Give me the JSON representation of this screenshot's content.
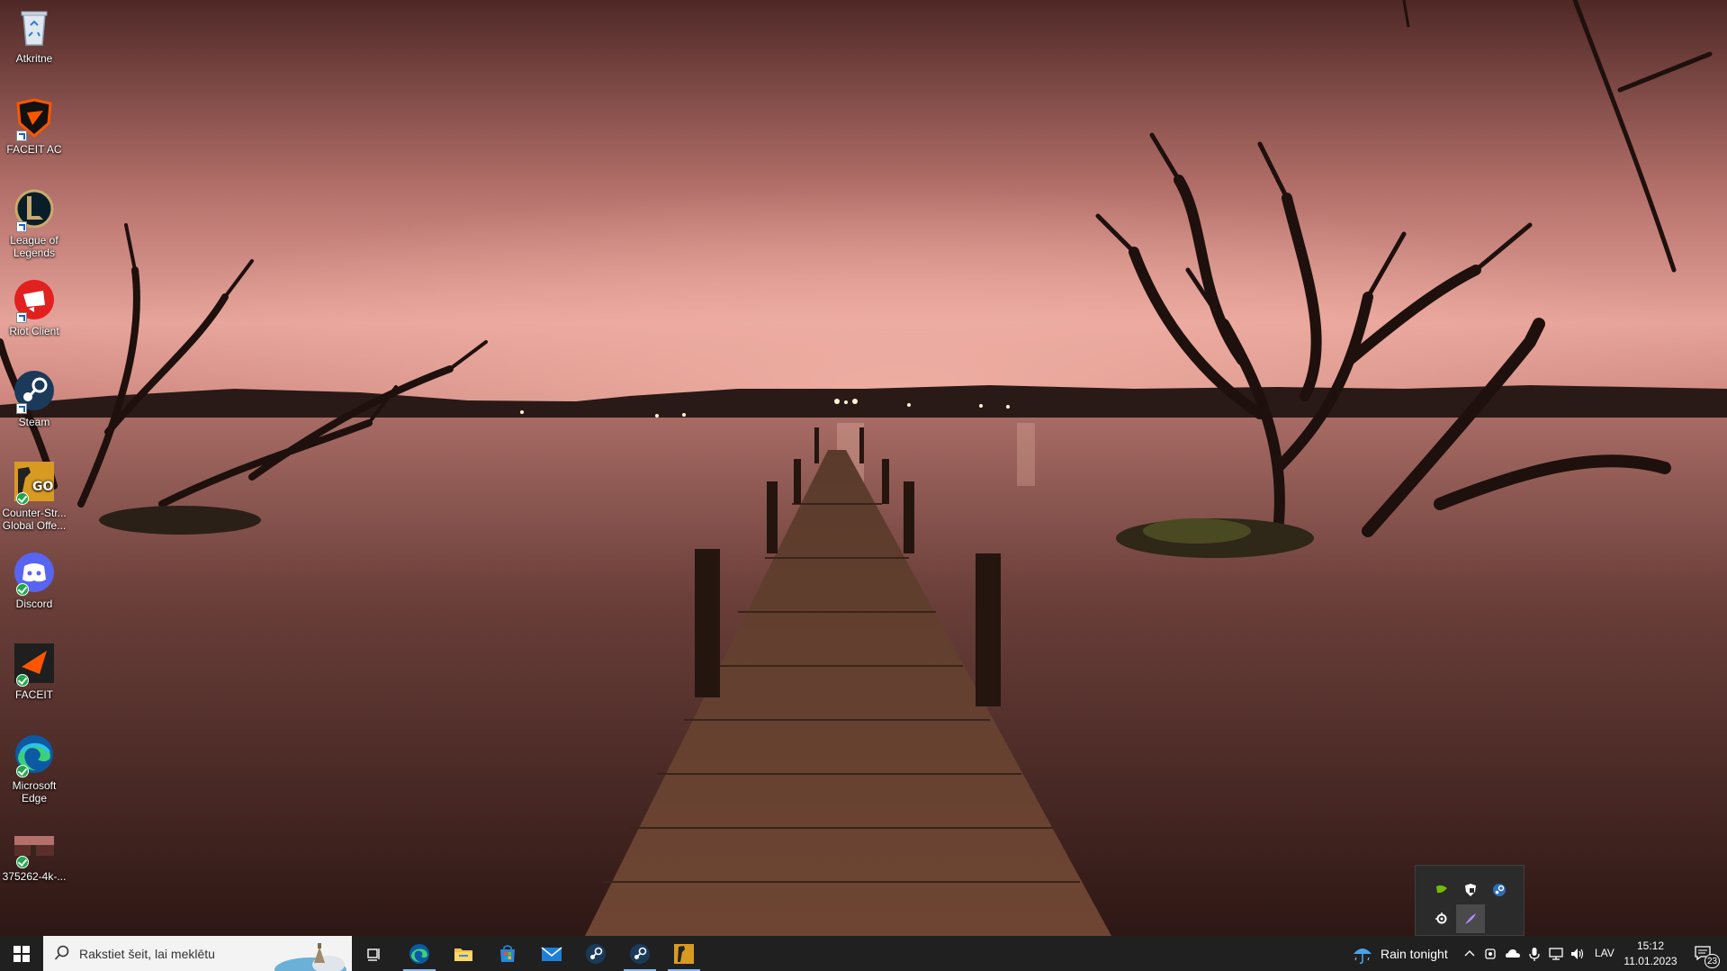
{
  "desktop": {
    "icons": [
      {
        "name": "recycle-bin-icon",
        "label": "Atkritne"
      },
      {
        "name": "faceit-ac-icon",
        "label": "FACEIT AC"
      },
      {
        "name": "league-of-legends-icon",
        "label": "League of Legends"
      },
      {
        "name": "riot-client-icon",
        "label": "Riot Client"
      },
      {
        "name": "steam-icon",
        "label": "Steam"
      },
      {
        "name": "csgo-icon",
        "label": "Counter-Str... Global Offe..."
      },
      {
        "name": "discord-icon",
        "label": "Discord"
      },
      {
        "name": "faceit-icon",
        "label": "FACEIT"
      },
      {
        "name": "microsoft-edge-icon",
        "label": "Microsoft Edge"
      },
      {
        "name": "wallpaper-file-icon",
        "label": "375262-4k-..."
      }
    ]
  },
  "taskbar": {
    "search_placeholder": "Rakstiet šeit, lai meklētu",
    "apps": [
      "task-view-icon",
      "edge-icon",
      "file-explorer-icon",
      "microsoft-store-icon",
      "mail-icon",
      "steam-icon",
      "steam-icon",
      "csgo-icon"
    ],
    "weather": "Rain tonight",
    "language": "LAV",
    "time": "15:12",
    "date": "11.01.2023",
    "notifications_count": "23"
  },
  "tray_overflow": {
    "icons": [
      "nvidia-icon",
      "security-shield-icon",
      "steam-icon",
      "steelseries-icon",
      "feather-icon"
    ]
  },
  "colors": {
    "taskbar": "#202020",
    "sky": "#c98279",
    "accent": "#8eb9ef"
  }
}
